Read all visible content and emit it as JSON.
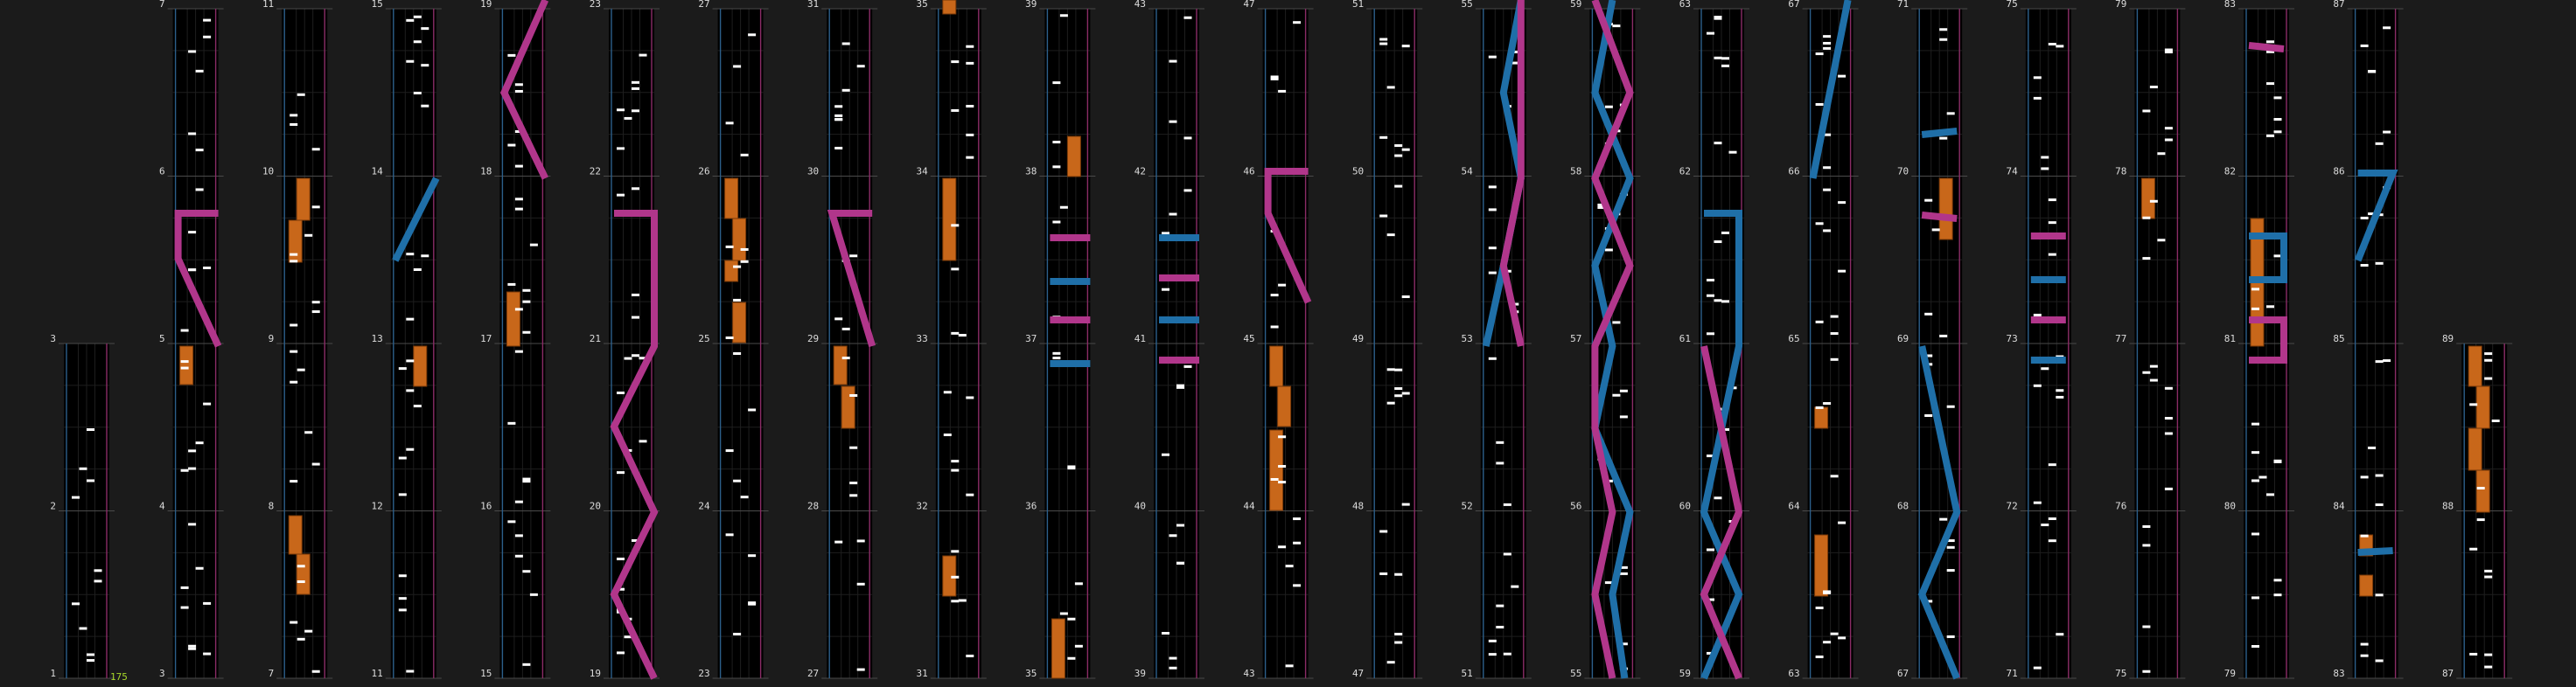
{
  "chart_data": {
    "type": "rhythm-game-chart",
    "bpm_label": "175",
    "measures": 89,
    "beats_per_measure": 4,
    "columns_measures": [
      [
        1,
        2,
        3
      ],
      [
        3,
        4,
        5,
        6,
        7
      ],
      [
        7,
        8,
        9,
        10,
        11
      ],
      [
        11,
        12,
        13,
        14,
        15
      ],
      [
        15,
        16,
        17,
        18,
        19
      ],
      [
        19,
        20,
        21,
        22,
        23
      ],
      [
        23,
        24,
        25,
        26,
        27
      ],
      [
        27,
        28,
        29,
        30,
        31
      ],
      [
        31,
        32,
        33,
        34,
        35
      ],
      [
        35,
        36,
        37,
        38,
        39
      ],
      [
        39,
        40,
        41,
        42,
        43
      ],
      [
        43,
        44,
        45,
        46,
        47
      ],
      [
        47,
        48,
        49,
        50,
        51
      ],
      [
        51,
        52,
        53,
        54,
        55
      ],
      [
        55,
        56,
        57,
        58,
        59
      ],
      [
        59,
        60,
        61,
        62,
        63
      ],
      [
        63,
        64,
        65,
        66,
        67
      ],
      [
        67,
        68,
        69,
        70,
        71
      ],
      [
        71,
        72,
        73,
        74,
        75
      ],
      [
        75,
        76,
        77,
        78,
        79
      ],
      [
        79,
        80,
        81,
        82,
        83
      ],
      [
        83,
        84,
        85,
        86,
        87
      ],
      [
        87,
        88,
        89
      ]
    ],
    "colors": {
      "background": "#1b1b1b",
      "lane": "#000000",
      "left_rail": "#2c5f8a",
      "right_rail": "#8a2c66",
      "tap": "#ffffff",
      "hold": "#c8671a",
      "blue_laser": "#1f6fa8",
      "pink_laser": "#b1368b",
      "bpm_text": "#a6d629"
    }
  }
}
